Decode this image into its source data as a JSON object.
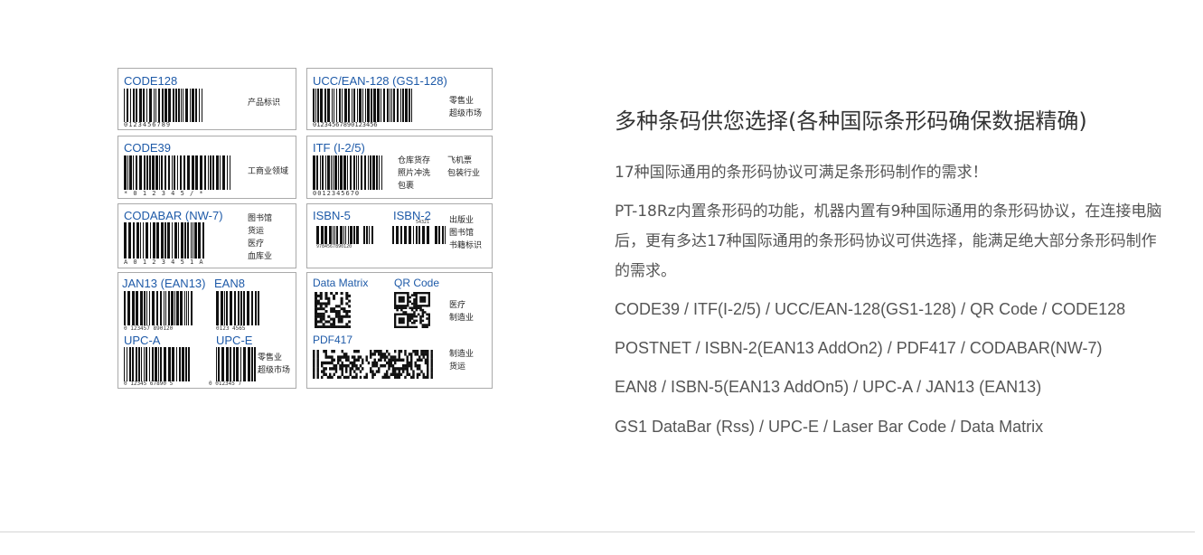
{
  "barcode_image": {
    "cells": [
      {
        "title": "CODE128",
        "tags": [
          "产品标识"
        ],
        "digits": "0123456789"
      },
      {
        "title": "UCC/EAN-128 (GS1-128)",
        "tags": [
          "零售业",
          "超级市场"
        ],
        "digits": "01234567890123456"
      },
      {
        "title": "CODE39",
        "tags": [
          "工商业领域"
        ],
        "digits": "*  0 1 2 3 4 5 /  *"
      },
      {
        "title": "ITF (I-2/5)",
        "tags": [
          "仓库货存",
          "照片冲洗",
          "包裹",
          "飞机票",
          "包装行业"
        ],
        "digits": "0012345670"
      },
      {
        "title": "CODABAR (NW-7)",
        "tags": [
          "图书馆",
          "货运",
          "医疗",
          "血库业"
        ],
        "digits": "A 0 1 2 3 4 5 1 A"
      },
      {
        "title_a": "ISBN-5",
        "title_b": "ISBN-2",
        "tags": [
          "出版业",
          "图书馆",
          "书籍标识"
        ],
        "digits_a": "9784567890120",
        "digits_b": "54321"
      },
      {
        "title_a": "JAN13 (EAN13)",
        "title_b": "EAN8",
        "title_c": "UPC-A",
        "title_d": "UPC-E",
        "tags": [
          "零售业",
          "超级市场"
        ],
        "digits_a": "0 123457 890120",
        "digits_b": "0123 4565",
        "digits_c": "0 12345 67890 5",
        "digits_d": "0 012345 7"
      },
      {
        "title_a": "Data Matrix",
        "title_b": "QR Code",
        "title_c": "PDF417",
        "tags_a": [
          "医疗",
          "制造业"
        ],
        "tags_b": [
          "制造业",
          "货运"
        ]
      }
    ]
  },
  "section": {
    "title": "多种条码供您选择(各种国际条形码确保数据精确)",
    "intro": "17种国际通用的条形码协议可满足条形码制作的需求！",
    "body": "PT-18Rz内置条形码的功能，机器内置有9种国际通用的条形码协议，在连接电脑后，更有多达17种国际通用的条形码协议可供选择，能满足绝大部分条形码制作的需求。",
    "code_lines": [
      "CODE39 / ITF(I-2/5) / UCC/EAN-128(GS1-128) / QR Code / CODE128",
      "POSTNET / ISBN-2(EAN13 AddOn2) / PDF417 / CODABAR(NW-7)",
      "EAN8 / ISBN-5(EAN13 AddOn5) / UPC-A / JAN13 (EAN13)",
      "GS1 DataBar (Rss) / UPC-E / Laser Bar Code / Data Matrix"
    ]
  }
}
